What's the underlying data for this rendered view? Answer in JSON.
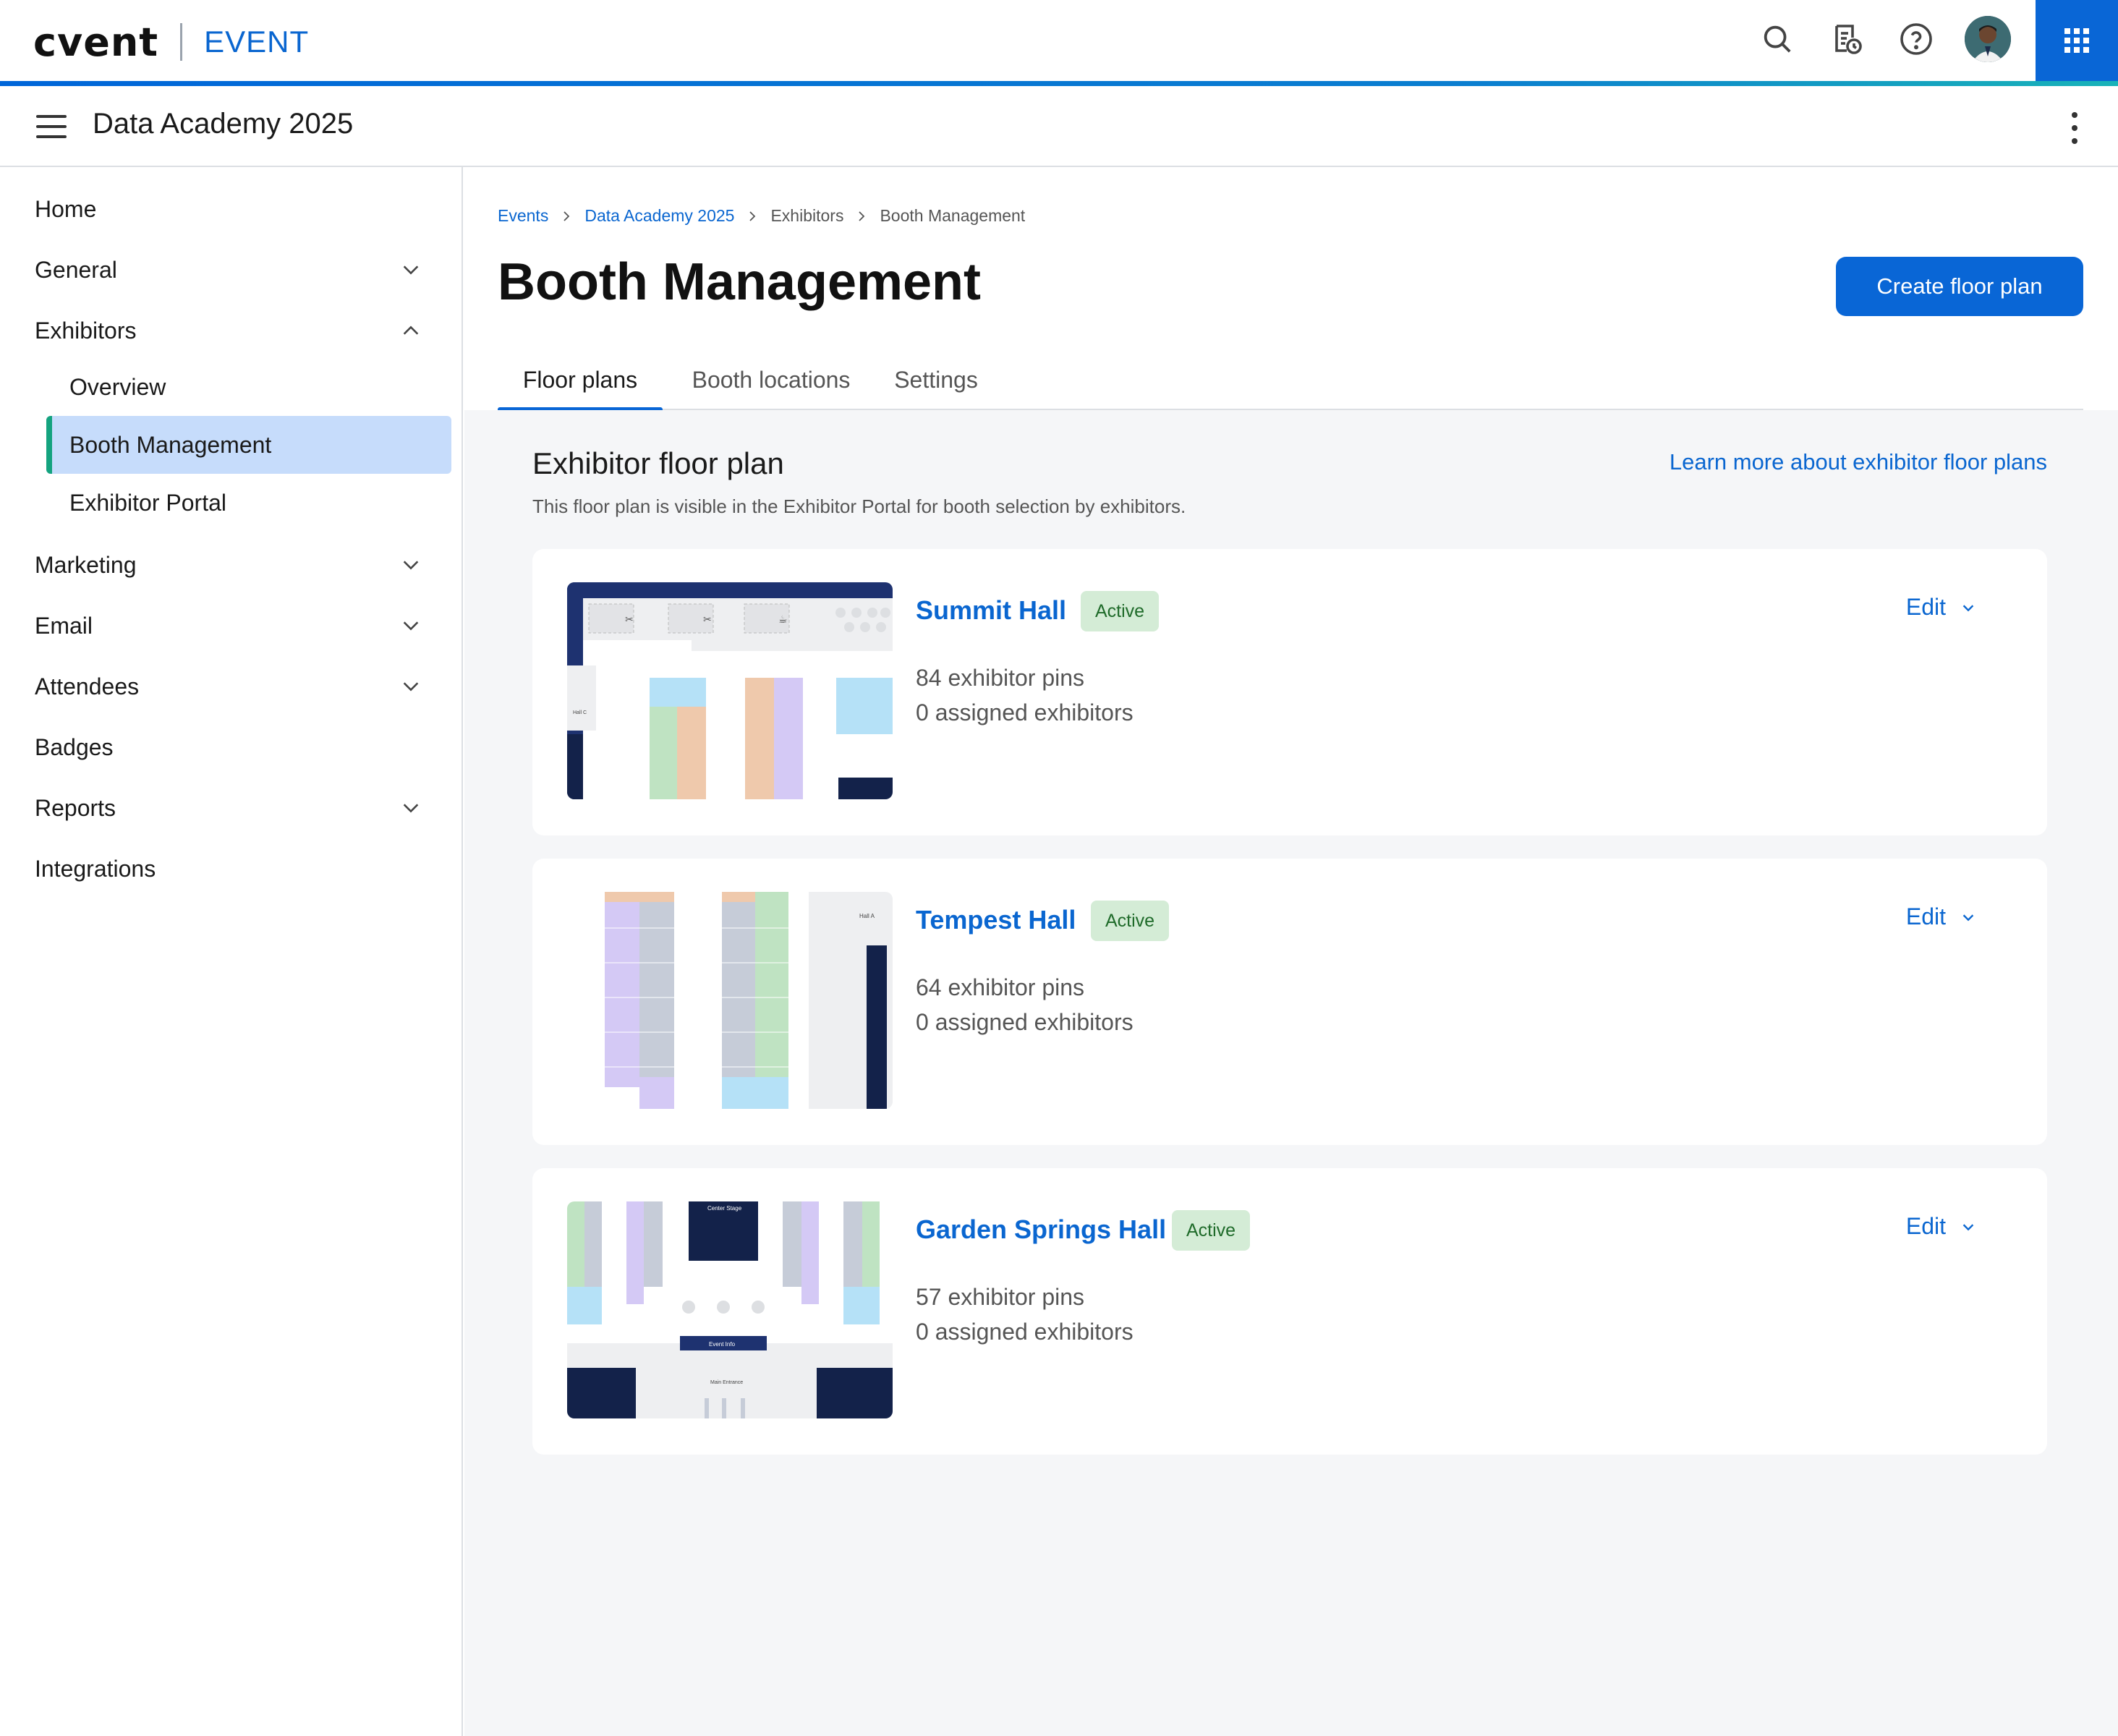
{
  "header": {
    "logo_text": "cvent",
    "product_label": "EVENT",
    "icons": [
      "search-icon",
      "event-schedule-icon",
      "help-icon",
      "user-avatar",
      "apps-grid-icon"
    ],
    "colors": {
      "accent": "#0966d6",
      "logo_c": "#10a6d9"
    }
  },
  "subheader": {
    "event_title": "Data Academy 2025"
  },
  "sidebar": {
    "items": [
      {
        "label": "Home"
      },
      {
        "label": "General"
      },
      {
        "label": "Exhibitors"
      },
      {
        "label": "Overview"
      },
      {
        "label": "Booth Management"
      },
      {
        "label": "Exhibitor Portal"
      },
      {
        "label": "Marketing"
      },
      {
        "label": "Email"
      },
      {
        "label": "Attendees"
      },
      {
        "label": "Badges"
      },
      {
        "label": "Reports"
      },
      {
        "label": "Integrations"
      }
    ]
  },
  "breadcrumb": [
    "Events",
    "Data Academy 2025",
    "Exhibitors",
    "Booth Management"
  ],
  "page": {
    "title": "Booth Management",
    "create_button": "Create floor plan",
    "tabs": [
      "Floor plans",
      "Booth locations",
      "Settings"
    ],
    "active_tab": "Floor plans"
  },
  "section": {
    "title": "Exhibitor floor plan",
    "learn_link": "Learn more about exhibitor floor plans",
    "description": "This floor plan is visible in the Exhibitor Portal for booth selection by exhibitors."
  },
  "floor_plans": [
    {
      "name": "Summit Hall",
      "status": "Active",
      "pins": "84 exhibitor pins",
      "assigned": "0 assigned exhibitors",
      "edit_label": "Edit"
    },
    {
      "name": "Tempest Hall",
      "status": "Active",
      "pins": "64 exhibitor pins",
      "assigned": "0 assigned exhibitors",
      "edit_label": "Edit"
    },
    {
      "name": "Garden Springs Hall",
      "status": "Active",
      "pins": "57 exhibitor pins",
      "assigned": "0 assigned exhibitors",
      "edit_label": "Edit"
    }
  ]
}
